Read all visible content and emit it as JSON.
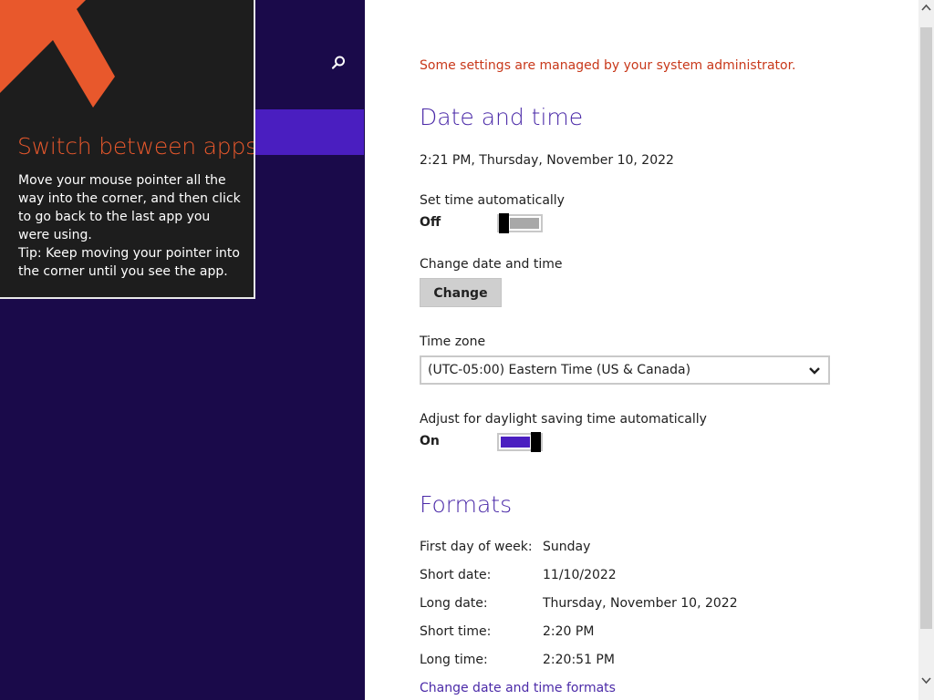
{
  "tip": {
    "title": "Switch between apps",
    "body_line1": "Move your mouse pointer all the way into the corner, and then click to go back to the last app you were using.",
    "body_line2": "Tip: Keep moving your pointer into the corner until you see the app.",
    "arrow_icon": "corner-arrow-icon",
    "accent_color": "#e8582c"
  },
  "nav": {
    "search_icon": "search-icon",
    "background_color": "#1a0a4a",
    "selected_color": "#4a1ec0"
  },
  "content": {
    "admin_note": "Some settings are managed by your system administrator.",
    "date_time": {
      "heading": "Date and time",
      "current": "2:21 PM, Thursday, November 10, 2022",
      "set_automatically": {
        "label": "Set time automatically",
        "state": "Off",
        "on": false
      },
      "change": {
        "label": "Change date and time",
        "button": "Change"
      },
      "time_zone": {
        "label": "Time zone",
        "selected": "(UTC-05:00) Eastern Time (US & Canada)"
      },
      "daylight_saving": {
        "label": "Adjust for daylight saving time automatically",
        "state": "On",
        "on": true
      }
    },
    "formats": {
      "heading": "Formats",
      "rows": [
        {
          "label": "First day of week:",
          "value": "Sunday"
        },
        {
          "label": "Short date:",
          "value": "11/10/2022"
        },
        {
          "label": "Long date:",
          "value": "Thursday, November 10, 2022"
        },
        {
          "label": "Short time:",
          "value": "2:20 PM"
        },
        {
          "label": "Long time:",
          "value": "2:20:51 PM"
        }
      ],
      "change_link": "Change date and time formats"
    },
    "accent_color": "#4b2aa8",
    "warning_color": "#c8381a"
  }
}
